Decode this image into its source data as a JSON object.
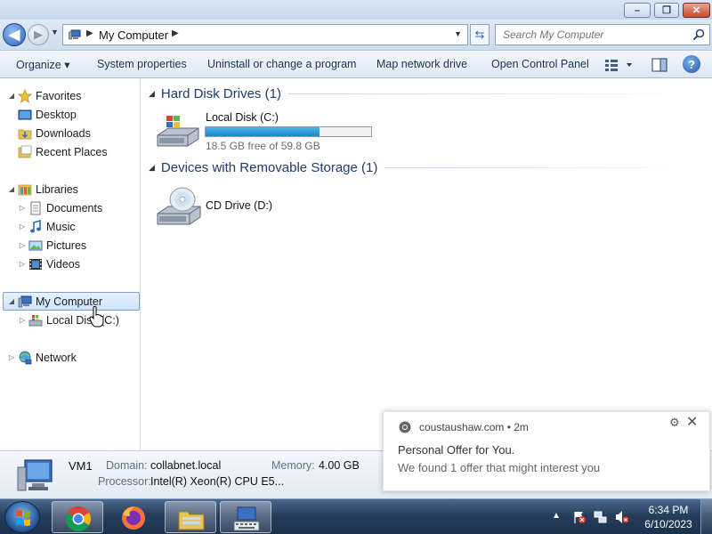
{
  "window": {
    "minimize_symbol": "–",
    "maximize_symbol": "❐",
    "close_symbol": "✕"
  },
  "nav": {
    "back_symbol": "◀",
    "forward_symbol": "▶",
    "address_path": "My Computer",
    "refresh_symbol": "⇆",
    "search_placeholder": "Search My Computer"
  },
  "commands": {
    "organize": "Organize ▾",
    "system_properties": "System properties",
    "uninstall": "Uninstall or change a program",
    "map_network_drive": "Map network drive",
    "open_control_panel": "Open Control Panel",
    "help_symbol": "?"
  },
  "navpane": {
    "favorites": "Favorites",
    "desktop": "Desktop",
    "downloads": "Downloads",
    "recent_places": "Recent Places",
    "libraries": "Libraries",
    "documents": "Documents",
    "music": "Music",
    "pictures": "Pictures",
    "videos": "Videos",
    "my_computer": "My Computer",
    "local_disk": "Local Disk (C:)",
    "network": "Network"
  },
  "content": {
    "hdd_group": "Hard Disk Drives (1)",
    "local_disk_name": "Local Disk (C:)",
    "local_disk_free": "18.5 GB free of 59.8 GB",
    "local_disk_used_fraction": 0.69,
    "removable_group": "Devices with Removable Storage (1)",
    "cd_drive_name": "CD Drive (D:)"
  },
  "details": {
    "name": "VM1",
    "domain_label": "Domain:",
    "domain_value": "collabnet.local",
    "memory_label": "Memory:",
    "memory_value": "4.00 GB",
    "processor_label": "Processor:",
    "processor_value": "Intel(R) Xeon(R) CPU E5..."
  },
  "notification": {
    "site": "coustaushaw.com  •  2m",
    "title": "Personal Offer for You.",
    "body": "We found 1 offer that might interest you",
    "gear_symbol": "⚙",
    "close_symbol": "✕"
  },
  "taskbar": {
    "tray_up_symbol": "▲",
    "time": "6:34 PM",
    "date": "6/10/2023"
  }
}
